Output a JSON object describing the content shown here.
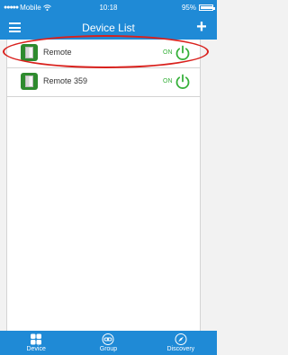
{
  "status_bar": {
    "signal": "●●●●●",
    "carrier": "Mobile",
    "wifi_icon": "wifi-icon",
    "time": "10:18",
    "battery_percent": "95%",
    "battery_level": 0.95
  },
  "nav": {
    "title": "Device List",
    "menu_icon": "menu-icon",
    "add_label": "+"
  },
  "devices": [
    {
      "name": "Remote",
      "state": "ON"
    },
    {
      "name": "Remote 359",
      "state": "ON"
    }
  ],
  "colors": {
    "primary": "#1f8ad6",
    "on_green": "#36b03a",
    "highlight_red": "#d9211d"
  },
  "tabs": [
    {
      "label": "Device",
      "icon": "grid-icon"
    },
    {
      "label": "Group",
      "icon": "link-icon"
    },
    {
      "label": "Discovery",
      "icon": "compass-icon"
    }
  ]
}
